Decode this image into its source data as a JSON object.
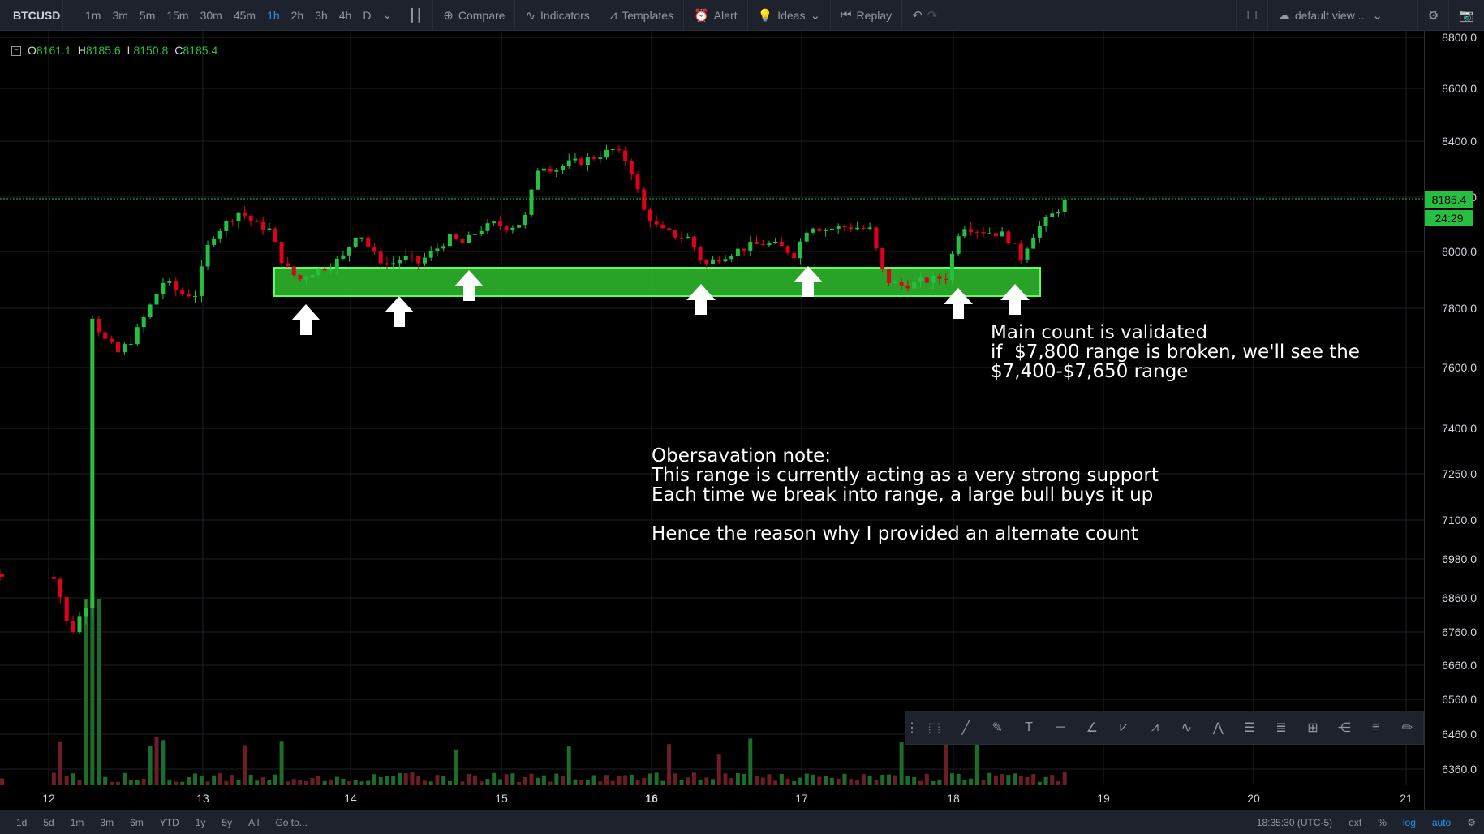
{
  "symbol": "BTCUSD",
  "intervals": [
    "1m",
    "3m",
    "5m",
    "15m",
    "30m",
    "45m",
    "1h",
    "2h",
    "3h",
    "4h",
    "D"
  ],
  "active_interval": "1h",
  "toolbar": {
    "compare": "Compare",
    "indicators": "Indicators",
    "templates": "Templates",
    "alert": "Alert",
    "ideas": "Ideas",
    "replay": "Replay",
    "default_view": "default view ..."
  },
  "ohlc": {
    "o_label": "O",
    "o": "8161.1",
    "h_label": "H",
    "h": "8185.6",
    "l_label": "L",
    "l": "8150.8",
    "c_label": "C",
    "c": "8185.4"
  },
  "price_axis": [
    "8800.0",
    "8600.0",
    "8400.0",
    "8200.0",
    "8000.0",
    "7800.0",
    "7600.0",
    "7400.0",
    "7250.0",
    "7100.0",
    "6980.0",
    "6860.0",
    "6760.0",
    "6660.0",
    "6560.0",
    "6460.0",
    "6360.0"
  ],
  "last_price": "8185.4",
  "countdown": "24:29",
  "time_axis": [
    "12",
    "13",
    "14",
    "15",
    "16",
    "17",
    "18",
    "19",
    "20",
    "21"
  ],
  "bottom": {
    "ranges": [
      "1d",
      "5d",
      "1m",
      "3m",
      "6m",
      "YTD",
      "1y",
      "5y",
      "All"
    ],
    "goto": "Go to...",
    "clock": "18:35:30 (UTC-5)",
    "ext": "ext",
    "percent": "%",
    "log": "log",
    "auto": "auto"
  },
  "annotations": {
    "main_count": "Main count is validated\nif  $7,800 range is broken, we'll see the\n$7,400-$7,650 range",
    "observation": "Obersavation note:\nThis range is currently acting as a very strong support\nEach time we break into range, a large bull buys it up\n\nHence the reason why I provided an alternate count"
  },
  "colors": {
    "up": "#26c041",
    "down": "#e0001b",
    "ema_cyan": "#2ee6ff",
    "ema_magenta": "#ff2bd6",
    "ema_orange": "#ff9a1f",
    "ema_yellow": "#ffee33",
    "ema_white": "#ffffff",
    "support_box": "#2fbf2f"
  }
}
